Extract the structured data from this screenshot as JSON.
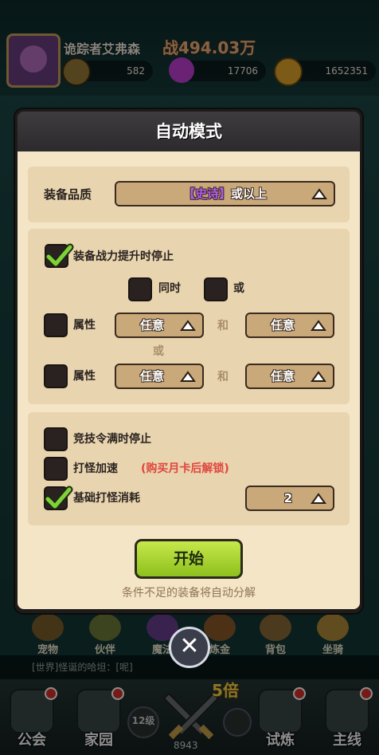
{
  "background": {
    "player_name": "诡踪者艾弗森",
    "power": "战494.03万",
    "resources": [
      {
        "icon": "ticket-icon",
        "value": "582"
      },
      {
        "icon": "gem-icon",
        "value": "17706"
      },
      {
        "icon": "coin-icon",
        "value": "1652351"
      }
    ],
    "side_icons": [
      {
        "label": "宠物"
      },
      {
        "label": "伙伴"
      },
      {
        "label": "魔法"
      },
      {
        "label": "炼金"
      },
      {
        "label": "背包"
      },
      {
        "label": "坐骑"
      }
    ],
    "chat": "[世界]怪诞的哈坦：[呢]",
    "multiplier": "5倍",
    "level": "12级",
    "nav": [
      {
        "label": "公会"
      },
      {
        "label": "家园"
      },
      {
        "label": ""
      },
      {
        "label": "试炼"
      },
      {
        "label": "主线"
      }
    ],
    "center_value": "8943"
  },
  "modal": {
    "title": "自动模式",
    "quality_label": "装备品质",
    "quality_value_tag": "【史诗】",
    "quality_value_suffix": "或以上",
    "stop_on_power_up": {
      "label": "装备战力提升时停止",
      "checked": true
    },
    "both_label": "同时",
    "or_label": "或",
    "attr_rows": [
      {
        "label": "属性",
        "left": "任意",
        "and": "和",
        "right": "任意"
      },
      {
        "label": "属性",
        "left": "任意",
        "and": "和",
        "right": "任意"
      }
    ],
    "between_or": "或",
    "arena_full_stop": {
      "label": "竞技令满时停止",
      "checked": false
    },
    "speed_up": {
      "label": "打怪加速",
      "checked": false,
      "lock_note": "(购买月卡后解锁)"
    },
    "base_cost": {
      "label": "基础打怪消耗",
      "checked": true,
      "value": "2"
    },
    "start_button": "开始",
    "hint": "条件不足的装备将自动分解",
    "accent_colors": {
      "epic": "#a04ee6",
      "lock_note": "#e0463f",
      "start": "#a6d32b"
    }
  }
}
